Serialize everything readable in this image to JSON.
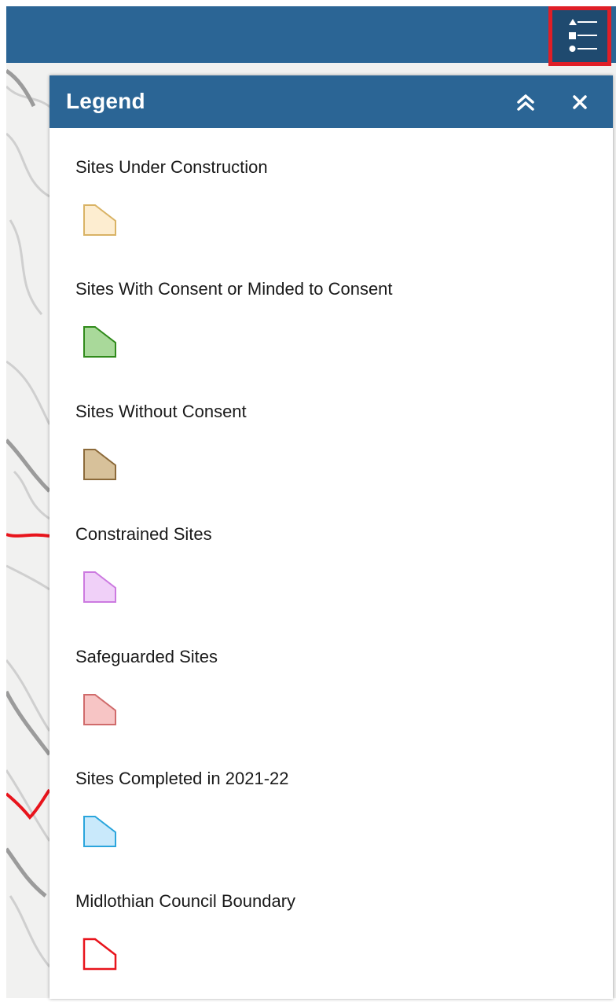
{
  "header": {
    "legend_toggle_icon": "legend-list-icon"
  },
  "legend": {
    "title": "Legend",
    "collapse_icon": "double-chevron-up-icon",
    "close_icon": "close-icon",
    "items": [
      {
        "label": "Sites Under Construction",
        "fill": "#fdedd0",
        "stroke": "#d9b365"
      },
      {
        "label": "Sites With Consent or Minded to Consent",
        "fill": "#a9d99a",
        "stroke": "#2f8a1a"
      },
      {
        "label": "Sites Without Consent",
        "fill": "#d7c19a",
        "stroke": "#8c6a3a"
      },
      {
        "label": "Constrained Sites",
        "fill": "#f0d0f8",
        "stroke": "#cc7ae0"
      },
      {
        "label": "Safeguarded Sites",
        "fill": "#f7c5c5",
        "stroke": "#d06b6b"
      },
      {
        "label": "Sites Completed in 2021-22",
        "fill": "#c9e9fb",
        "stroke": "#2aa5dc"
      },
      {
        "label": "Midlothian Council Boundary",
        "fill": "#ffffff",
        "stroke": "#e8141c"
      }
    ]
  },
  "colors": {
    "header": "#2b6595",
    "toggle_background": "#1f4a6f",
    "toggle_highlight": "#e01e26"
  }
}
